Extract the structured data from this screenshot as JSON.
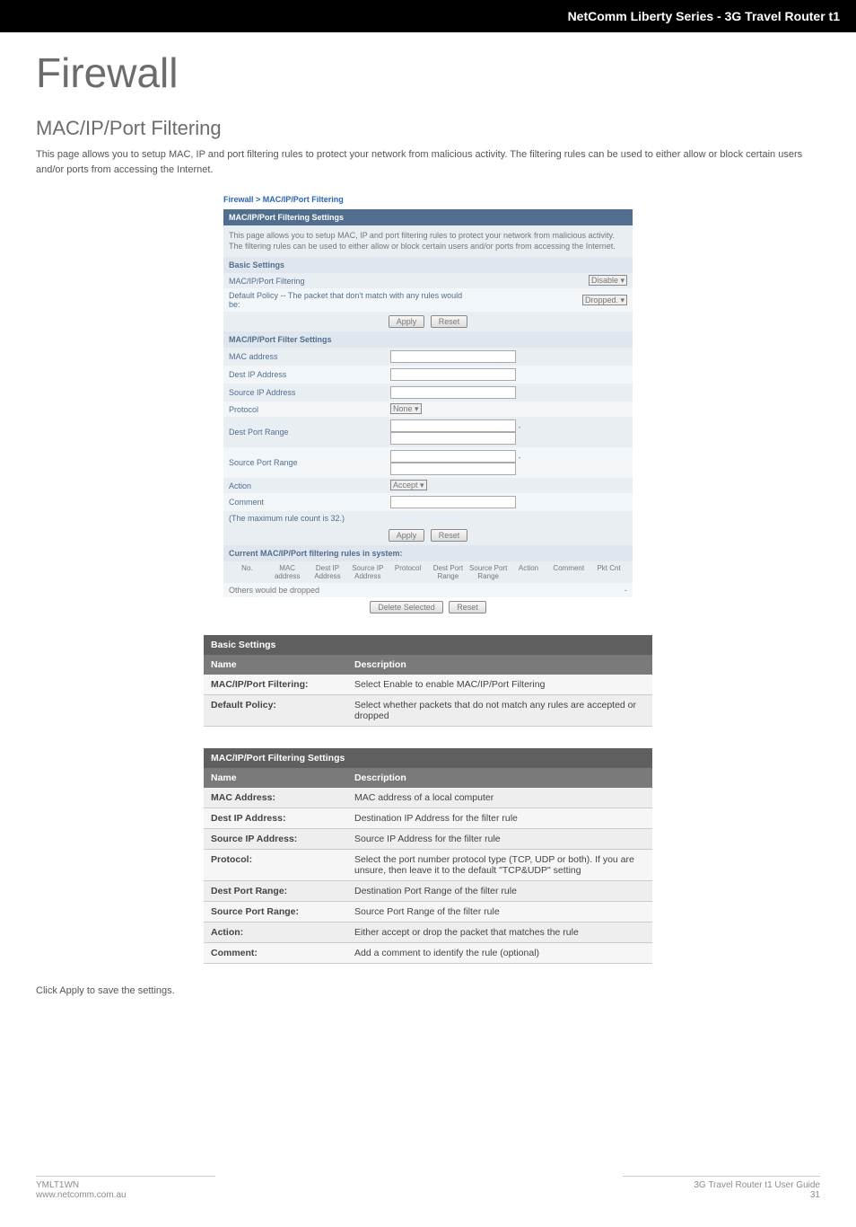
{
  "header": {
    "title_bar": "NetComm Liberty Series - 3G Travel Router t1"
  },
  "page_title": "Firewall",
  "section_title": "MAC/IP/Port Filtering",
  "intro_text": "This page allows you to setup MAC, IP and port filtering rules to protect your network from malicious activity. The filtering rules can be used to either allow or block certain users and/or ports from accessing the Internet.",
  "screenshot": {
    "breadcrumb": "Firewall > MAC/IP/Port Filtering",
    "panel_title": "MAC/IP/Port Filtering Settings",
    "description": "This page allows you to setup MAC, IP and port filtering rules to protect your network from malicious activity. The filtering rules can be used to either allow or block certain users and/or ports from accessing the Internet.",
    "basic_settings_label": "Basic Settings",
    "row_filtering_label": "MAC/IP/Port Filtering",
    "row_filtering_value": "Disable",
    "row_default_policy_label": "Default Policy -- The packet that don't match with any rules would be:",
    "row_default_policy_value": "Dropped.",
    "apply_label": "Apply",
    "reset_label": "Reset",
    "filter_settings_label": "MAC/IP/Port Filter Settings",
    "labels": {
      "mac_address": "MAC address",
      "dest_ip": "Dest IP Address",
      "source_ip": "Source IP Address",
      "protocol": "Protocol",
      "protocol_value": "None",
      "dest_port_range": "Dest Port Range",
      "source_port_range": "Source Port Range",
      "action": "Action",
      "action_value": "Accept",
      "comment": "Comment",
      "max_rule": "(The maximum rule count is 32.)"
    },
    "current_rules_label": "Current MAC/IP/Port filtering rules in system:",
    "rules_cols": {
      "no": "No.",
      "mac_address": "MAC address",
      "dest_ip": "Dest IP Address",
      "source_ip": "Source IP Address",
      "protocol": "Protocol",
      "dest_port": "Dest Port Range",
      "source_port": "Source Port Range",
      "action": "Action",
      "comment": "Comment",
      "pkt_cnt": "Pkt Cnt"
    },
    "others_dropped": "Others would be dropped",
    "delete_selected": "Delete Selected",
    "reset2": "Reset"
  },
  "tables": {
    "basic_settings": {
      "title": "Basic Settings",
      "col_name": "Name",
      "col_desc": "Description",
      "rows": [
        {
          "name": "MAC/IP/Port Filtering:",
          "desc": "Select Enable to enable MAC/IP/Port Filtering"
        },
        {
          "name": "Default Policy:",
          "desc": "Select whether packets that do not match any rules are accepted or dropped"
        }
      ]
    },
    "filtering_settings": {
      "title": "MAC/IP/Port Filtering Settings",
      "col_name": "Name",
      "col_desc": "Description",
      "rows": [
        {
          "name": "MAC Address:",
          "desc": "MAC address of a local computer"
        },
        {
          "name": "Dest IP Address:",
          "desc": "Destination IP Address for the filter rule"
        },
        {
          "name": "Source IP Address:",
          "desc": "Source IP Address for the filter rule"
        },
        {
          "name": "Protocol:",
          "desc": "Select the port number protocol type (TCP, UDP or both). If you are unsure, then leave it to the default \"TCP&UDP\" setting"
        },
        {
          "name": "Dest Port Range:",
          "desc": "Destination Port Range of the filter rule"
        },
        {
          "name": "Source Port Range:",
          "desc": "Source Port Range of the filter rule"
        },
        {
          "name": "Action:",
          "desc": "Either accept or drop the packet that matches the rule"
        },
        {
          "name": "Comment:",
          "desc": "Add a comment to identify the rule (optional)"
        }
      ]
    }
  },
  "save_note": "Click Apply to save the settings.",
  "footer": {
    "left_line1": "YMLT1WN",
    "left_line2": "www.netcomm.com.au",
    "right_line1": "3G Travel Router t1 User Guide",
    "right_line2": "31"
  }
}
